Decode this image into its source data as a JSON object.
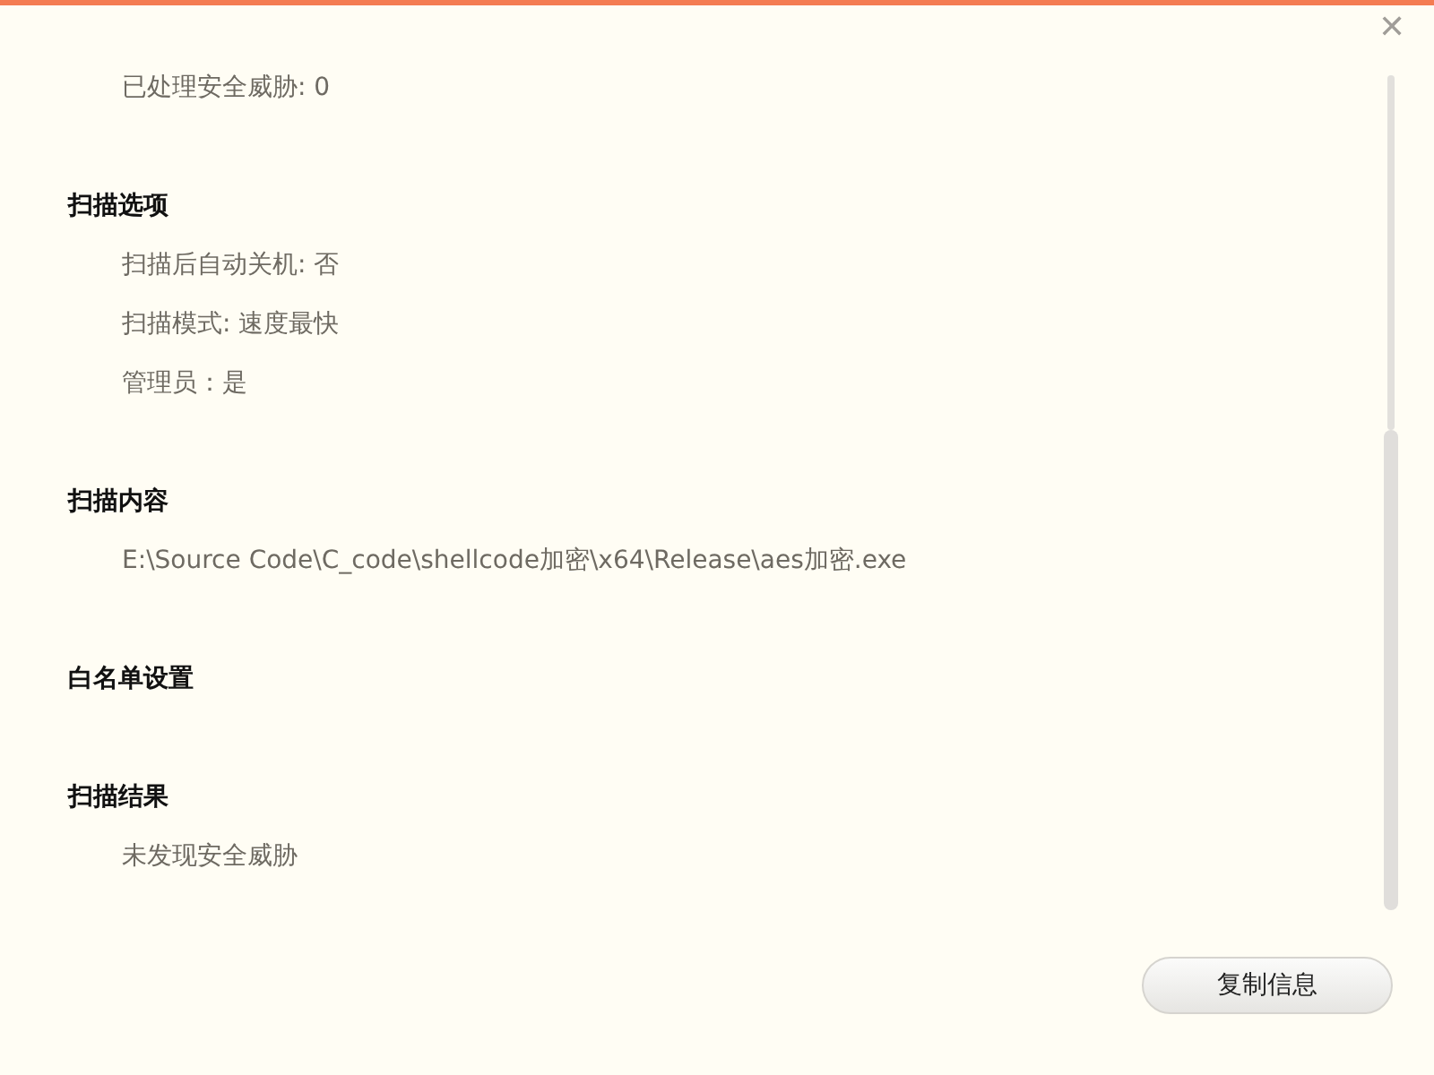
{
  "sections": [
    {
      "items": [
        "已处理安全威胁: 0"
      ]
    },
    {
      "heading": "扫描选项",
      "items": [
        "扫描后自动关机: 否",
        "扫描模式: 速度最快",
        "管理员：是"
      ]
    },
    {
      "heading": "扫描内容",
      "items": [
        "E:\\Source Code\\C_code\\shellcode加密\\x64\\Release\\aes加密.exe"
      ]
    },
    {
      "heading": "白名单设置"
    },
    {
      "heading": "扫描结果",
      "items": [
        "未发现安全威胁"
      ]
    }
  ],
  "close_button": "✕",
  "copy_button": "复制信息"
}
